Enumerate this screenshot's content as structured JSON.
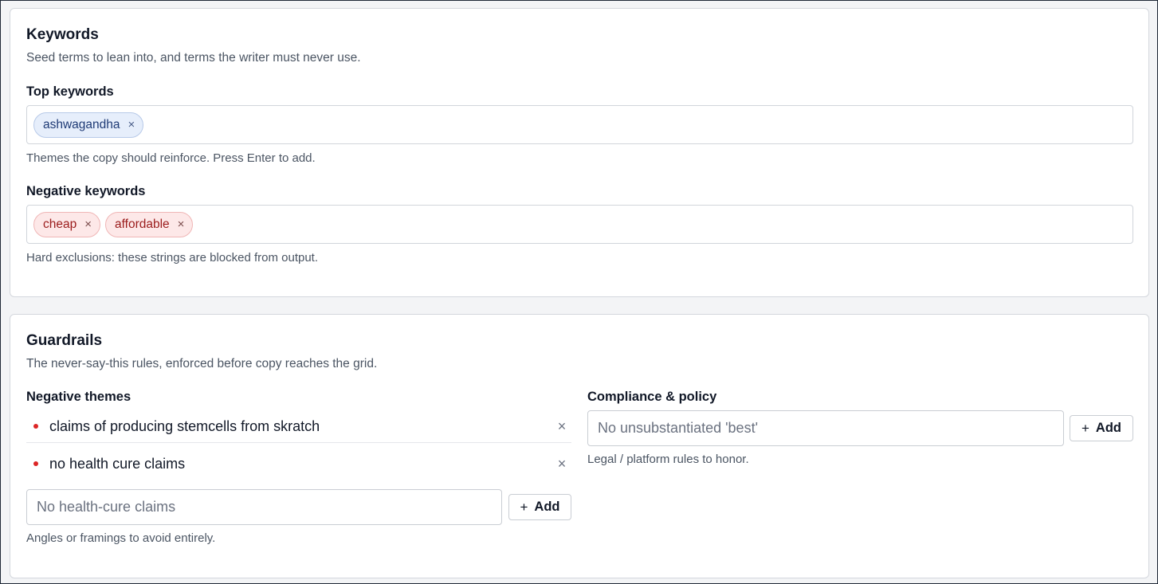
{
  "keywords": {
    "title": "Keywords",
    "subtitle": "Seed terms to lean into, and terms the writer must never use.",
    "top": {
      "label": "Top keywords",
      "chips": [
        "ashwagandha"
      ],
      "hint": "Themes the copy should reinforce. Press Enter to add."
    },
    "negative": {
      "label": "Negative keywords",
      "chips": [
        "cheap",
        "affordable"
      ],
      "hint": "Hard exclusions: these strings are blocked from output."
    },
    "remove_glyph": "×"
  },
  "guardrails": {
    "title": "Guardrails",
    "subtitle": "The never-say-this rules, enforced before copy reaches the grid.",
    "negative_themes": {
      "label": "Negative themes",
      "items": [
        "claims of producing stemcells from skratch",
        "no health cure claims"
      ],
      "input_placeholder": "No health-cure claims",
      "add_label": "Add",
      "hint": "Angles or framings to avoid entirely."
    },
    "compliance": {
      "label": "Compliance & policy",
      "input_placeholder": "No unsubstantiated 'best'",
      "add_label": "Add",
      "hint": "Legal / platform rules to honor."
    }
  },
  "icons": {
    "remove": "close-icon",
    "add": "plus-icon",
    "bullet": "bullet-dot-icon"
  },
  "colors": {
    "positive_chip_bg": "#e6eefb",
    "positive_chip_text": "#1e3a75",
    "negative_chip_bg": "#fde8e8",
    "negative_chip_text": "#9b1c1c",
    "bullet": "#dc2626"
  }
}
